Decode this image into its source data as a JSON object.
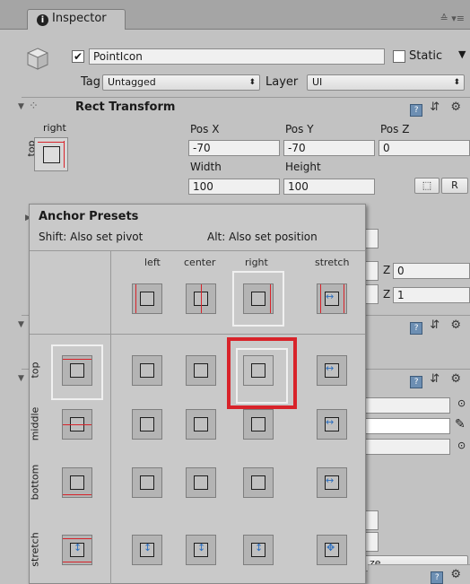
{
  "window": {
    "tab_label": "Inspector",
    "tab_tools": "≙ ▾≡"
  },
  "gameobject": {
    "active": true,
    "name": "PointIcon",
    "static_label": "Static",
    "tag_label": "Tag",
    "tag_value": "Untagged",
    "layer_label": "Layer",
    "layer_value": "UI"
  },
  "rect_transform": {
    "title": "Rect Transform",
    "anchor_label": "right",
    "anchor_vlabel": "top",
    "pos_x_label": "Pos X",
    "pos_x": "-70",
    "pos_y_label": "Pos Y",
    "pos_y": "-70",
    "pos_z_label": "Pos Z",
    "pos_z": "0",
    "width_label": "Width",
    "width": "100",
    "height_label": "Height",
    "height": "100",
    "blueprint_button": "⬚",
    "raw_button": "R"
  },
  "behind": {
    "z1_label": "Z",
    "z1": "0",
    "z2_label": "Z",
    "z2": "1",
    "misc_text": "ze"
  },
  "anchor_presets": {
    "title": "Anchor Presets",
    "hint_shift": "Shift: Also set pivot",
    "hint_alt": "Alt: Also set position",
    "columns": [
      "left",
      "center",
      "right",
      "stretch"
    ],
    "rows": [
      "top",
      "middle",
      "bottom",
      "stretch"
    ],
    "selected": "top-right",
    "colors": {
      "highlight": "#d8232a",
      "anchor_line": "#d8232a",
      "stretch_arrow": "#2d6fbf"
    }
  }
}
